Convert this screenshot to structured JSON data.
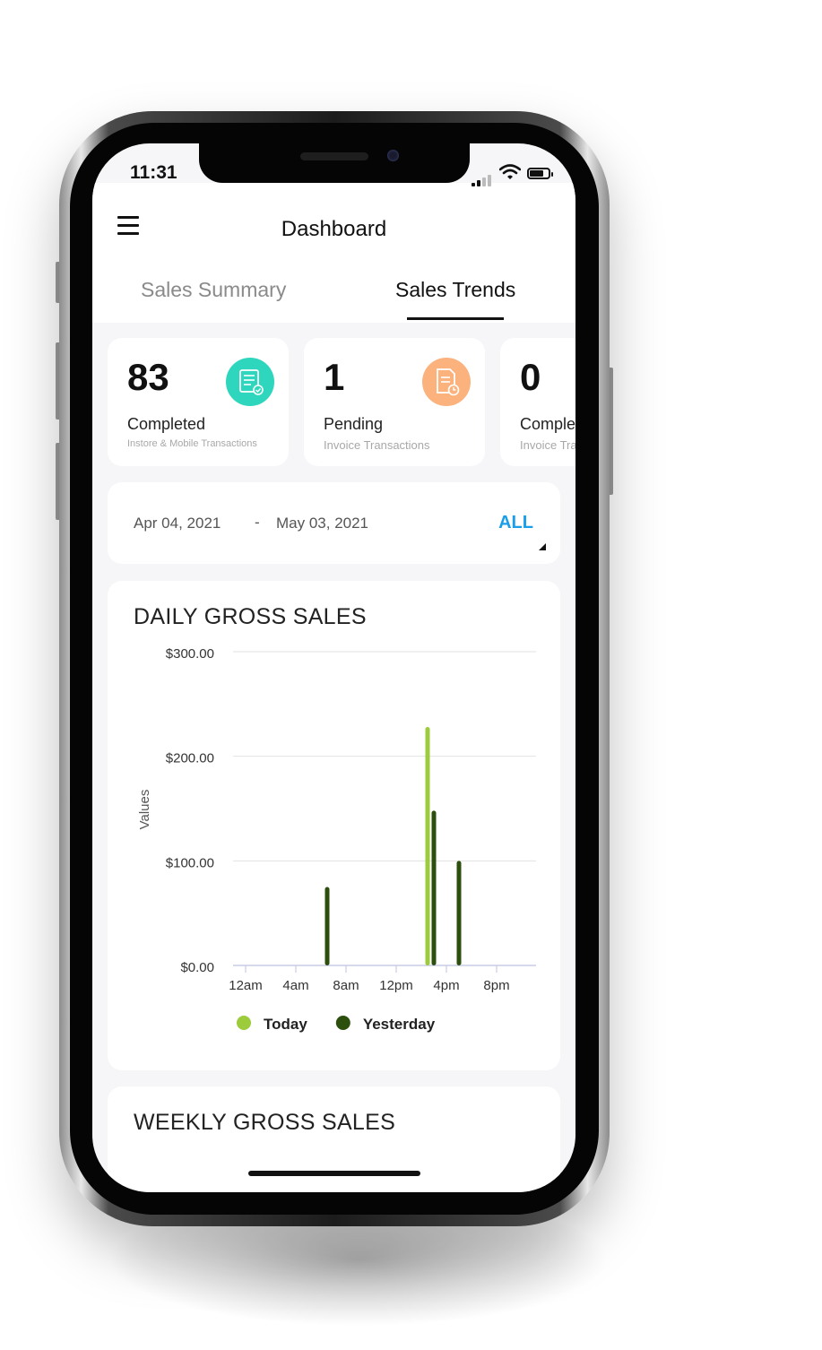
{
  "status_bar": {
    "time": "11:31"
  },
  "header": {
    "title": "Dashboard"
  },
  "tabs": [
    {
      "label": "Sales Summary",
      "active": false
    },
    {
      "label": "Sales Trends",
      "active": true
    }
  ],
  "stats": [
    {
      "value": "83",
      "label": "Completed",
      "sublabel": "Instore & Mobile Transactions",
      "icon": "checklist-icon",
      "icon_color": "#2ed6bd"
    },
    {
      "value": "1",
      "label": "Pending",
      "sublabel": "Invoice Transactions",
      "icon": "invoice-clock-icon",
      "icon_color": "#fbb27d"
    },
    {
      "value": "0",
      "label": "Completed",
      "sublabel": "Invoice Transactions"
    }
  ],
  "date_range": {
    "from": "Apr 04, 2021",
    "separator": "-",
    "to": "May 03, 2021",
    "filter": "ALL",
    "filter_color": "#1a9ee8"
  },
  "daily_section": {
    "title": "DAILY GROSS SALES"
  },
  "weekly_section": {
    "title": "WEEKLY GROSS SALES"
  },
  "chart_data": {
    "type": "bar",
    "title": "DAILY GROSS SALES",
    "xlabel": "",
    "ylabel": "Values",
    "x_ticks": [
      "12am",
      "4am",
      "8am",
      "12pm",
      "4pm",
      "8pm"
    ],
    "y_ticks": [
      "$0.00",
      "$100.00",
      "$200.00",
      "$300.00"
    ],
    "ylim": [
      0,
      300
    ],
    "xlim": [
      0,
      24
    ],
    "grid": true,
    "legend_position": "bottom",
    "series": [
      {
        "name": "Today",
        "color": "#9ccc3c",
        "points": [
          {
            "hour": 14.5,
            "value": 228
          }
        ]
      },
      {
        "name": "Yesterday",
        "color": "#2d4f0e",
        "points": [
          {
            "hour": 6.5,
            "value": 75
          },
          {
            "hour": 15.0,
            "value": 148
          },
          {
            "hour": 17.0,
            "value": 100
          }
        ]
      }
    ]
  }
}
